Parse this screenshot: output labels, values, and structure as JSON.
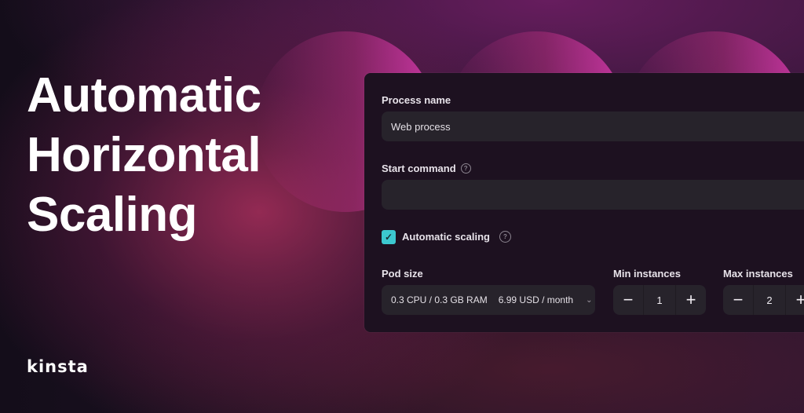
{
  "hero": {
    "lines": [
      "Automatic",
      "Horizontal",
      "Scaling"
    ]
  },
  "brand": {
    "logo_text": "kinsta"
  },
  "form": {
    "process_name": {
      "label": "Process name",
      "value": "Web process"
    },
    "start_command": {
      "label": "Start command",
      "value": "",
      "help_icon": "question-circle-icon"
    },
    "automatic_scaling": {
      "label": "Automatic scaling",
      "checked": true,
      "help_icon": "question-circle-icon"
    },
    "pod_size": {
      "label": "Pod size",
      "resources": "0.3 CPU / 0.3 GB RAM",
      "price": "6.99 USD / month"
    },
    "min_instances": {
      "label": "Min instances",
      "value": "1"
    },
    "max_instances": {
      "label": "Max instances",
      "value": "2"
    }
  },
  "colors": {
    "accent": "#3cc8cf",
    "panel": "#1d1120",
    "field": "#27232b",
    "arc": "#cd37a5"
  }
}
